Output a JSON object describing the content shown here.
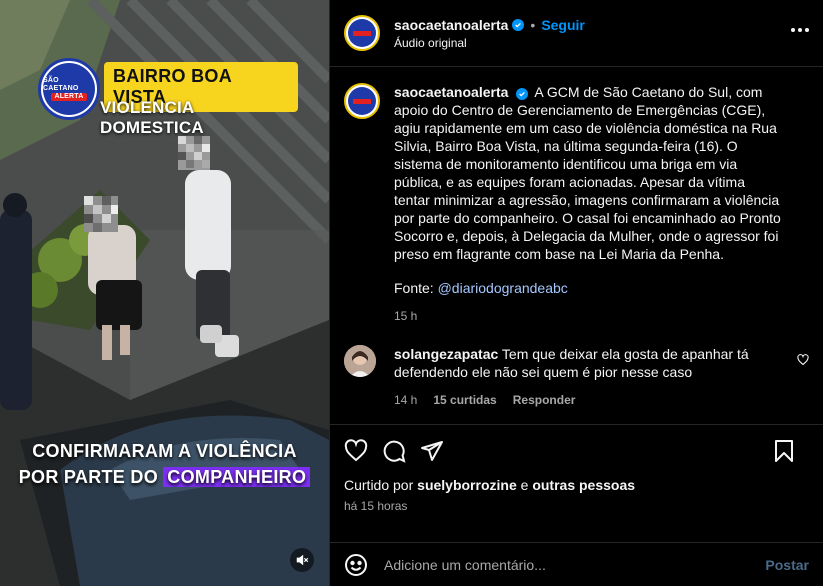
{
  "video": {
    "logo_line1": "SÃO CAETANO",
    "logo_line2": "ALERTA",
    "title_tag": "BAIRRO BOA VISTA",
    "subtitle_tag": "VIOLENCIA DOMESTICA",
    "caption_line1": "CONFIRMARAM A VIOLÊNCIA",
    "caption_line2_prefix": "POR PARTE DO ",
    "caption_line2_highlight": "COMPANHEIRO"
  },
  "header": {
    "username": "saocaetanoalerta",
    "follow_label": "Seguir",
    "audio_label": "Áudio original"
  },
  "post": {
    "username": "saocaetanoalerta",
    "caption": "A GCM de São Caetano do Sul, com apoio do Centro de Gerenciamento de Emergências (CGE), agiu rapidamente em um caso de violência doméstica na Rua Silvia, Bairro Boa Vista, na última segunda-feira (16). O sistema de monitoramento identificou uma briga em via pública, e as equipes foram acionadas. Apesar da vítima tentar minimizar a agressão, imagens confirmaram a violência por parte do companheiro. O casal foi encaminhado ao Pronto Socorro e, depois, à Delegacia da Mulher, onde o agressor foi preso em flagrante com base na Lei Maria da Penha.",
    "source_prefix": "Fonte: ",
    "source_handle": "@diariodograndeabc",
    "time": "15 h"
  },
  "comment": {
    "username": "solangezapatac",
    "text": "Tem que deixar ela gosta de apanhar tá defendendo ele não sei quem é pior nesse caso",
    "time": "14 h",
    "likes": "15 curtidas",
    "reply_label": "Responder"
  },
  "actions": {
    "liked_by_prefix": "Curtido por ",
    "liked_by_user": "suelyborrozine",
    "liked_by_mid": " e ",
    "liked_by_rest": "outras pessoas",
    "posted_ago": "há 15 horas"
  },
  "composer": {
    "placeholder": "Adicione um comentário...",
    "post_label": "Postar"
  },
  "colors": {
    "accent": "#0095f6",
    "tag_yellow": "#f7d41e",
    "highlight_purple": "#7b2ff0",
    "logo_blue": "#1e3aa8",
    "logo_red": "#e42121"
  }
}
